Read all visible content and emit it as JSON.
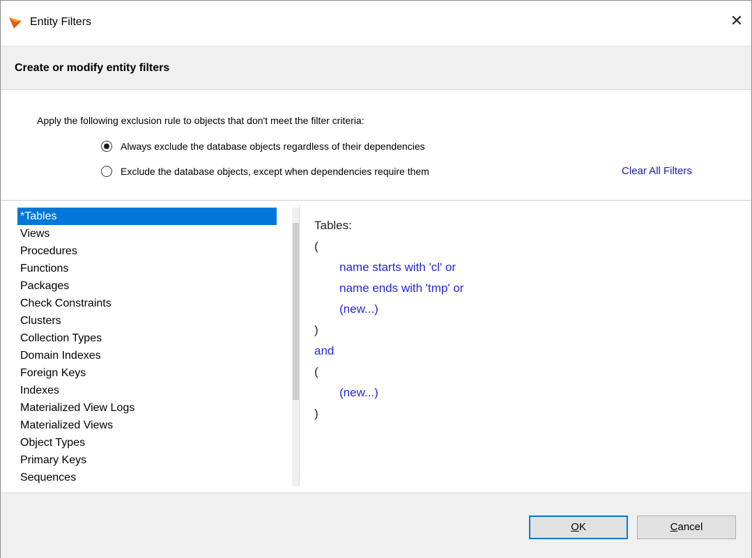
{
  "window": {
    "title": "Entity Filters",
    "close_glyph": "✕"
  },
  "header": {
    "text": "Create or modify entity filters"
  },
  "options": {
    "instruction": "Apply the following exclusion rule to objects that don't meet the filter criteria:",
    "radio1_label": "Always exclude the database objects regardless of their dependencies",
    "radio1_checked": true,
    "radio2_label": "Exclude the database objects, except when dependencies  require them",
    "radio2_checked": false,
    "clear_link": "Clear All Filters"
  },
  "entity_list": {
    "items": [
      "*Tables",
      "Views",
      "Procedures",
      "Functions",
      "Packages",
      "Check Constraints",
      "Clusters",
      "Collection Types",
      "Domain Indexes",
      "Foreign Keys",
      "Indexes",
      "Materialized View Logs",
      "Materialized Views",
      "Object Types",
      "Primary Keys",
      "Sequences"
    ],
    "selected_index": 0,
    "scroll_up_glyph": "^",
    "scroll_down_glyph": "v"
  },
  "filter_editor": {
    "heading": "Tables:",
    "open1": "(",
    "cond1": "name starts with 'cl' or",
    "cond2": "name ends with 'tmp' or",
    "new1": "(new...)",
    "close1": ")",
    "and": "and",
    "open2": "(",
    "new2": "(new...)",
    "close2": ")"
  },
  "buttons": {
    "ok_mnemonic": "O",
    "ok_rest": "K",
    "cancel_mnemonic": "C",
    "cancel_rest": "ancel"
  },
  "colors": {
    "selection": "#0078d7",
    "link_blue": "#1a1aa6",
    "editor_blue": "#2626d9"
  },
  "icons": {
    "app": "app-logo-icon",
    "close": "close-icon",
    "scroll_up": "chevron-up-icon",
    "scroll_down": "chevron-down-icon"
  }
}
